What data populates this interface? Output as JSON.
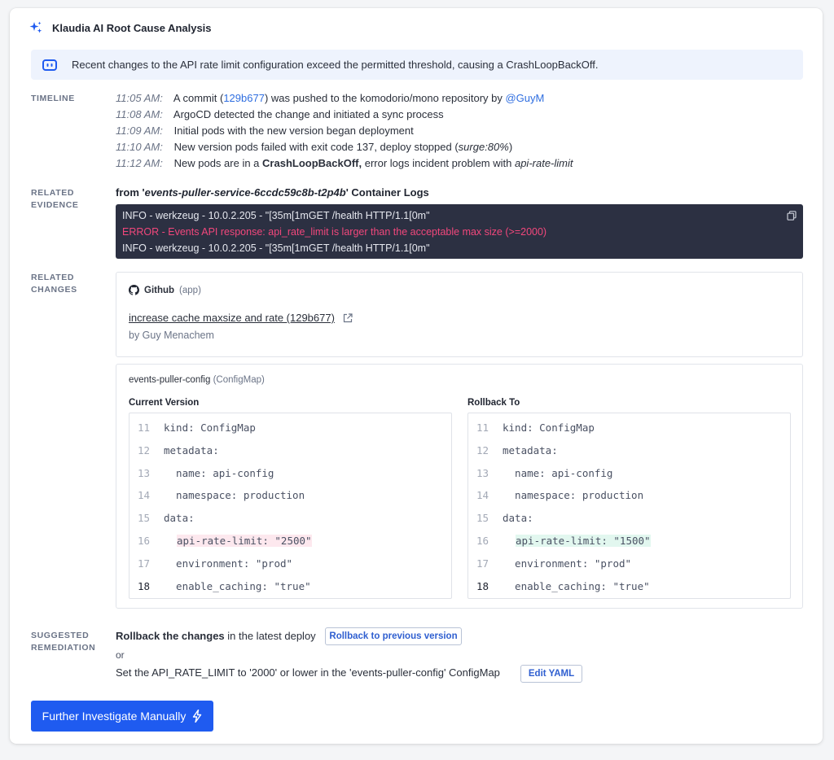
{
  "header": {
    "title": "Klaudia AI Root Cause Analysis",
    "icon": "sparkle-icon"
  },
  "banner": {
    "text": "Recent changes to the API rate limit configuration exceed the permitted threshold, causing a CrashLoopBackOff.",
    "icon": "bot-icon"
  },
  "sections": {
    "timeline": "TIMELINE",
    "evidence": [
      "RELATED",
      "EVIDENCE"
    ],
    "changes": [
      "RELATED",
      "CHANGES"
    ],
    "remediation": [
      "SUGGESTED",
      "REMEDIATION"
    ]
  },
  "timeline": [
    {
      "time": "11:05 AM:",
      "pre": "A commit (",
      "commit": "129b677",
      "mid": ") was pushed to the komodorio/mono repository by ",
      "user": "@GuyM"
    },
    {
      "time": "11:08 AM:",
      "text": "ArgoCD detected the change and initiated a sync process"
    },
    {
      "time": "11:09 AM:",
      "text": "Initial pods with the new version began deployment"
    },
    {
      "time": "11:10 AM:",
      "pre": "New version pods failed with exit code 137, deploy stopped (",
      "em": "surge:80%",
      "post": ")"
    },
    {
      "time": "11:12 AM:",
      "pre": "New pods are in a ",
      "strong": "CrashLoopBackOff,",
      "mid": " error logs incident problem with ",
      "em": "api-rate-limit"
    }
  ],
  "evidence": {
    "prefix": "from '",
    "source": "events-puller-service-6ccdc59c8b-t2p4b",
    "suffix": "' Container Logs",
    "logs": [
      {
        "level": "info",
        "text": "INFO - werkzeug - 10.0.2.205 - \"[35m[1mGET /health HTTP/1.1[0m\""
      },
      {
        "level": "error",
        "text": "ERROR - Events API response: api_rate_limit is larger than the acceptable max size (>=2000)"
      },
      {
        "level": "info",
        "text": "INFO - werkzeug - 10.0.2.205 - \"[35m[1mGET /health HTTP/1.1[0m\""
      }
    ],
    "error_color": "#f2477c",
    "log_bg": "#2c3042"
  },
  "github": {
    "name": "Github",
    "sub": "(app)",
    "commit_title": "increase cache maxsize and rate (129b677)",
    "author": "by Guy Menachem"
  },
  "config": {
    "name": "events-puller-config",
    "sub": "(ConfigMap)",
    "current_label": "Current Version",
    "rollback_label": "Rollback To",
    "current_lines": [
      {
        "n": "11",
        "text": "kind: ConfigMap"
      },
      {
        "n": "12",
        "text": "metadata:"
      },
      {
        "n": "13",
        "text": "  name: api-config"
      },
      {
        "n": "14",
        "text": "  namespace: production"
      },
      {
        "n": "15",
        "text": "data:"
      },
      {
        "n": "16",
        "text": "api-rate-limit: \"2500\""
      },
      {
        "n": "17",
        "text": "  environment: \"prod\""
      },
      {
        "n": "18",
        "text": "  enable_caching: \"true\""
      }
    ],
    "rollback_lines": [
      {
        "n": "11",
        "text": "kind: ConfigMap"
      },
      {
        "n": "12",
        "text": "metadata:"
      },
      {
        "n": "13",
        "text": "  name: api-config"
      },
      {
        "n": "14",
        "text": "  namespace: production"
      },
      {
        "n": "15",
        "text": "data:"
      },
      {
        "n": "16",
        "text": "api-rate-limit: \"1500\""
      },
      {
        "n": "17",
        "text": "  environment: \"prod\""
      },
      {
        "n": "18",
        "text": "  enable_caching: \"true\""
      }
    ]
  },
  "remediation": {
    "step1_strong": "Rollback the changes",
    "step1_rest": " in the latest deploy",
    "rollback_button": "Rollback to previous version",
    "or": "or",
    "step2": "Set the API_RATE_LIMIT to '2000' or lower in the 'events-puller-config' ConfigMap",
    "edit_button": "Edit YAML"
  },
  "primary_button": "Further Investigate Manually",
  "colors": {
    "accent": "#1f5bf0",
    "link": "#2f6ee0",
    "banner_bg": "#eef3fd"
  }
}
